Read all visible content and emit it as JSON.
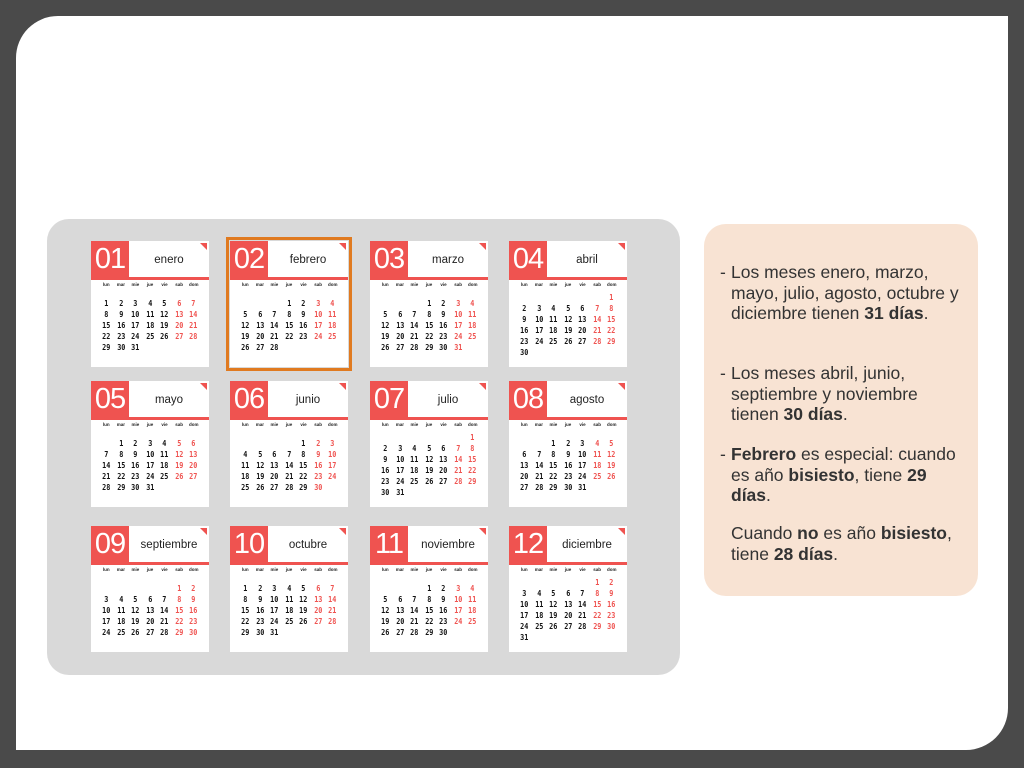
{
  "weekdays": [
    "lun",
    "mar",
    "mie",
    "jue",
    "vie",
    "sab",
    "dom"
  ],
  "colors": {
    "accent": "#ef5350",
    "selected": "#e07a20",
    "panel": "#d9d9d9",
    "info_bg": "#f8e3d3"
  },
  "months": [
    {
      "num": "01",
      "name": "enero",
      "first_weekday": 0,
      "days": 31
    },
    {
      "num": "02",
      "name": "febrero",
      "first_weekday": 3,
      "days": 28,
      "selected": true
    },
    {
      "num": "03",
      "name": "marzo",
      "first_weekday": 3,
      "days": 31
    },
    {
      "num": "04",
      "name": "abril",
      "first_weekday": 6,
      "days": 30
    },
    {
      "num": "05",
      "name": "mayo",
      "first_weekday": 1,
      "days": 31
    },
    {
      "num": "06",
      "name": "junio",
      "first_weekday": 4,
      "days": 30
    },
    {
      "num": "07",
      "name": "julio",
      "first_weekday": 6,
      "days": 31
    },
    {
      "num": "08",
      "name": "agosto",
      "first_weekday": 2,
      "days": 31
    },
    {
      "num": "09",
      "name": "septiembre",
      "first_weekday": 5,
      "days": 30
    },
    {
      "num": "10",
      "name": "octubre",
      "first_weekday": 0,
      "days": 31
    },
    {
      "num": "11",
      "name": "noviembre",
      "first_weekday": 3,
      "days": 30
    },
    {
      "num": "12",
      "name": "diciembre",
      "first_weekday": 5,
      "days": 31
    }
  ],
  "info": [
    {
      "dash": "-",
      "segments": [
        {
          "text": "Los meses enero, marzo, mayo, julio, agosto, octubre y diciembre tienen "
        },
        {
          "text": "31 días",
          "bold": true
        },
        {
          "text": "."
        }
      ]
    },
    {
      "dash": "-",
      "segments": [
        {
          "text": "Los meses abril, junio, septiembre y noviembre tienen "
        },
        {
          "text": "30 días",
          "bold": true
        },
        {
          "text": "."
        }
      ]
    },
    {
      "dash": "-",
      "segments": [
        {
          "text": "Febrero",
          "bold": true
        },
        {
          "text": " es especial: cuando es año "
        },
        {
          "text": "bisiesto",
          "bold": true
        },
        {
          "text": ", tiene "
        },
        {
          "text": "29 días",
          "bold": true
        },
        {
          "text": "."
        }
      ]
    },
    {
      "dash": "",
      "segments": [
        {
          "text": "Cuando "
        },
        {
          "text": "no",
          "bold": true
        },
        {
          "text": " es año "
        },
        {
          "text": "bisiesto",
          "bold": true
        },
        {
          "text": ", tiene "
        },
        {
          "text": "28 días",
          "bold": true
        },
        {
          "text": "."
        }
      ]
    }
  ]
}
